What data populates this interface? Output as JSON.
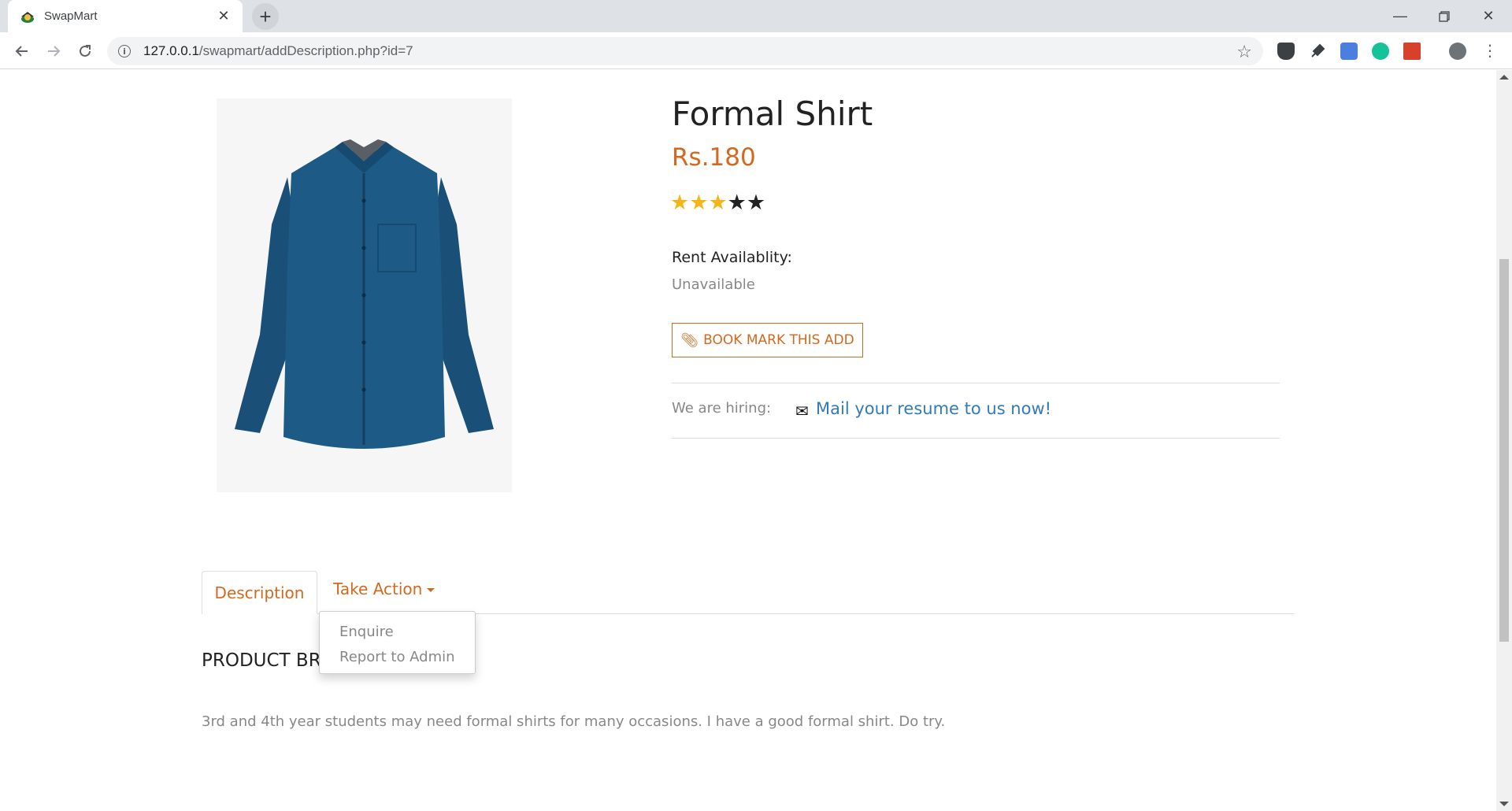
{
  "browser": {
    "tab_title": "SwapMart",
    "url_host": "127.0.0.1",
    "url_path": "/swapmart/addDescription.php?id=7"
  },
  "product": {
    "name": "Formal Shirt",
    "price": "Rs.180",
    "rating": 3,
    "rating_max": 5,
    "rent_label": "Rent Availablity:",
    "rent_value": "Unavailable",
    "bookmark_label": "BOOK MARK THIS ADD",
    "hiring_label": "We are hiring:",
    "mail_link": "Mail your resume to us now!",
    "image_color": "#1d5a85"
  },
  "tabs": {
    "description": "Description",
    "take_action": "Take Action"
  },
  "dropdown": {
    "items": [
      "Enquire",
      "Report to Admin"
    ]
  },
  "content": {
    "section_title": "PRODUCT BR",
    "description": "3rd and 4th year students may need formal shirts for many occasions. I have a good formal shirt. Do try."
  },
  "colors": {
    "accent": "#d2691e",
    "link": "#337ab7",
    "star": "#f5b516"
  }
}
